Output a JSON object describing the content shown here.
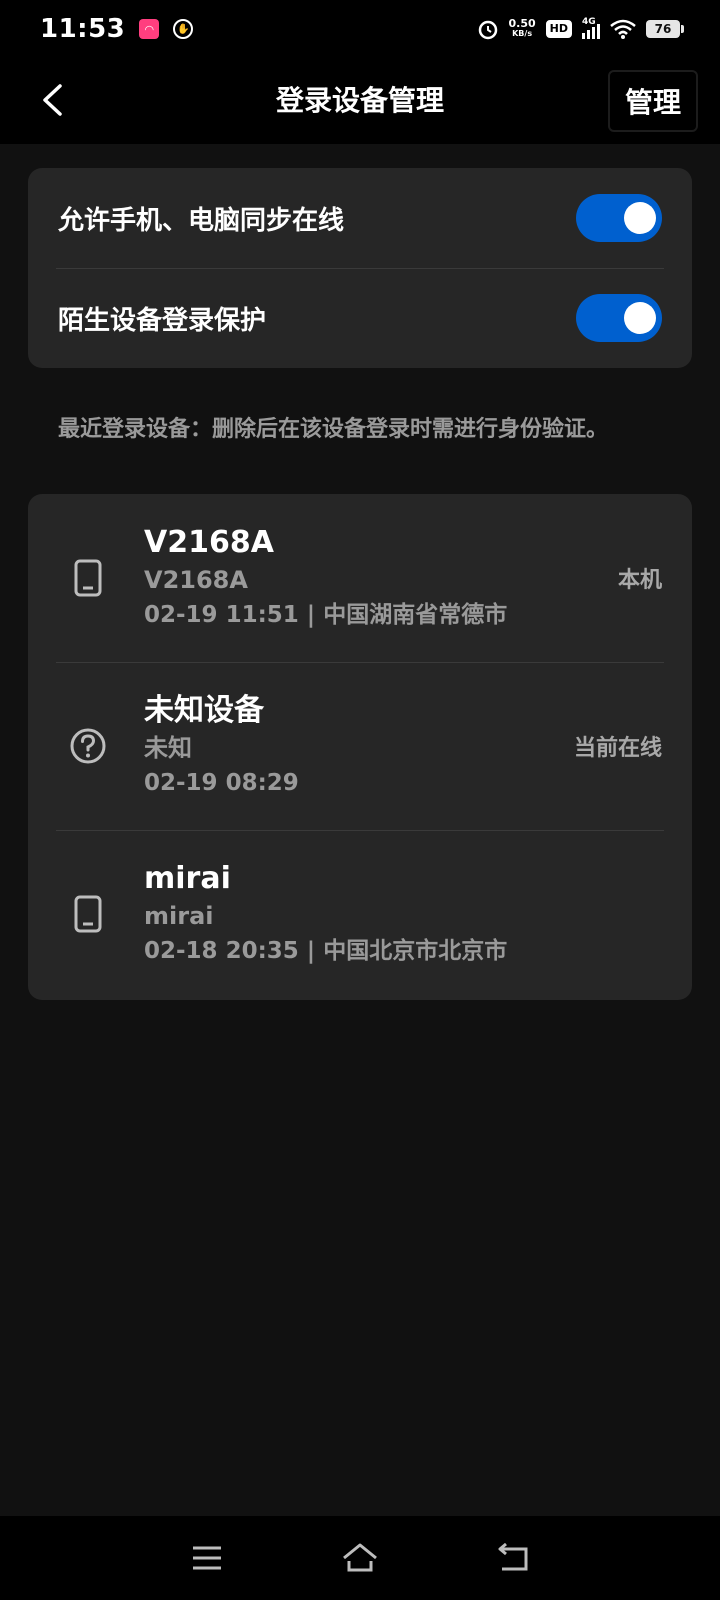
{
  "status_bar": {
    "time": "11:53",
    "net_speed_value": "0.50",
    "net_speed_unit": "KB/s",
    "hd_label": "HD",
    "network_label": "4G",
    "battery_level": "76"
  },
  "header": {
    "title": "登录设备管理",
    "manage_label": "管理"
  },
  "settings": {
    "items": [
      {
        "label": "允许手机、电脑同步在线",
        "enabled": true
      },
      {
        "label": "陌生设备登录保护",
        "enabled": true
      }
    ]
  },
  "hint_text": "最近登录设备：删除后在该设备登录时需进行身份验证。",
  "devices": [
    {
      "name": "V2168A",
      "model": "V2168A",
      "meta": "02-19 11:51 | 中国湖南省常德市",
      "status": "本机",
      "icon": "phone-icon"
    },
    {
      "name": "未知设备",
      "model": "未知",
      "meta": "02-19 08:29",
      "status": "当前在线",
      "icon": "question-icon"
    },
    {
      "name": "mirai",
      "model": "mirai",
      "meta": "02-18 20:35 | 中国北京市北京市",
      "status": "",
      "icon": "phone-icon"
    }
  ],
  "colors": {
    "accent": "#0060cf",
    "background": "#111111",
    "card": "#262626"
  }
}
